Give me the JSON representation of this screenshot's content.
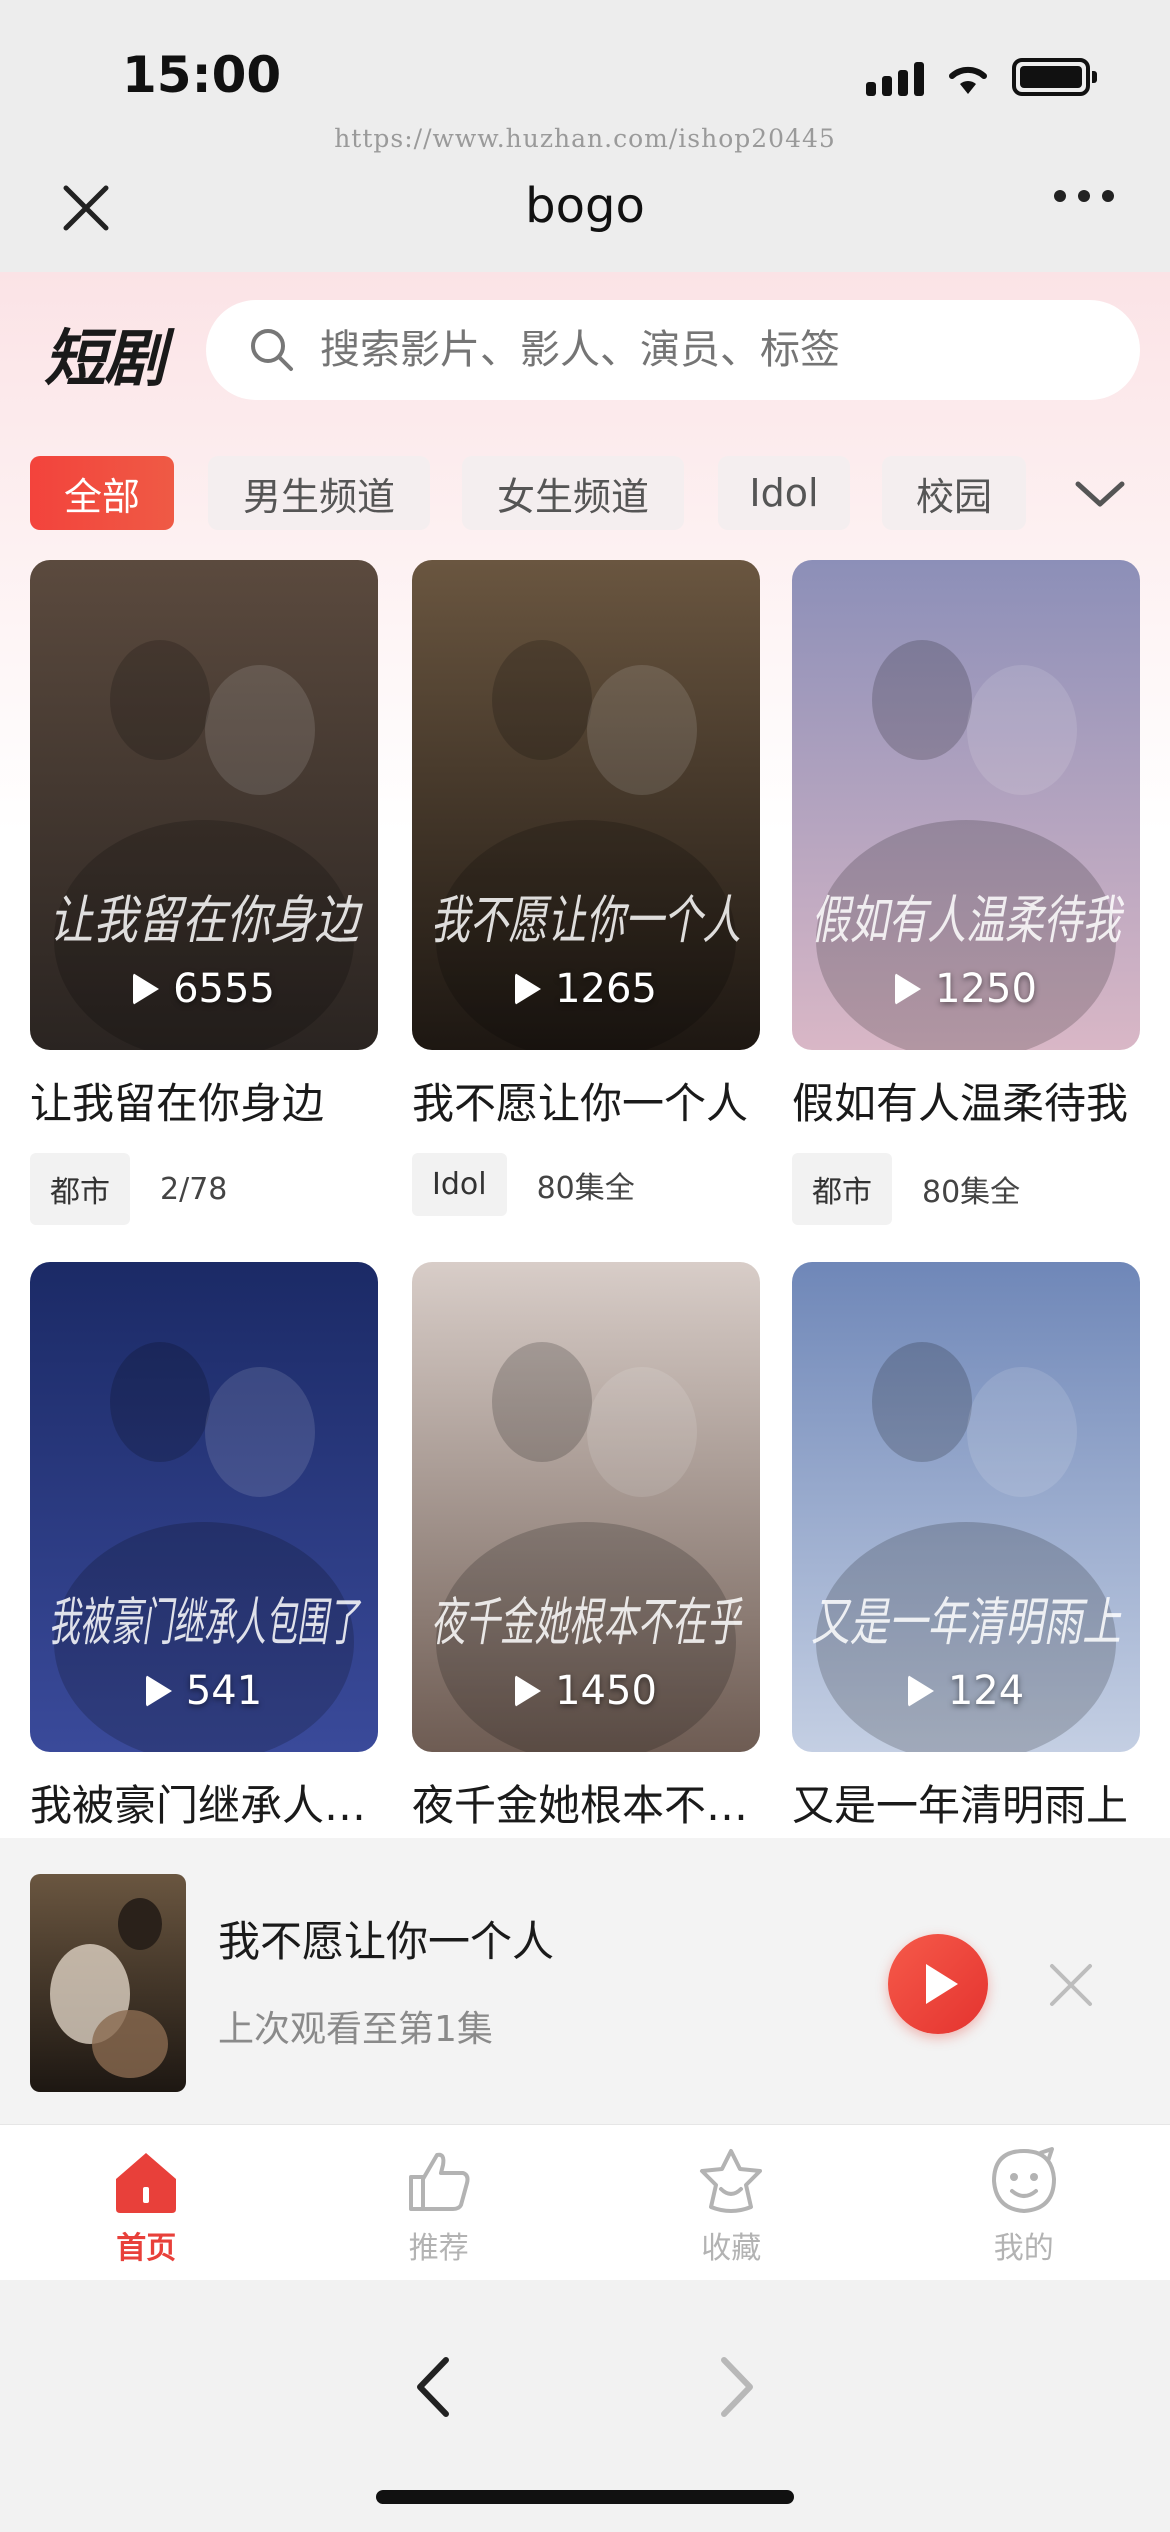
{
  "status": {
    "time": "15:00"
  },
  "watermark": "https://www.huzhan.com/ishop20445",
  "nav": {
    "title": "bogo"
  },
  "header": {
    "brand": "短剧",
    "search_placeholder": "搜索影片、影人、演员、标签"
  },
  "chips": [
    {
      "label": "全部",
      "active": true
    },
    {
      "label": "男生频道",
      "active": false
    },
    {
      "label": "女生频道",
      "active": false
    },
    {
      "label": "Idol",
      "active": false
    },
    {
      "label": "校园",
      "active": false
    }
  ],
  "dramas": [
    {
      "title": "让我留在你身边",
      "plays": "6555",
      "tag": "都市",
      "episodes": "2/78",
      "poster_text": "让我留在你身边",
      "colors": [
        "#5b4a3e",
        "#2a2421"
      ]
    },
    {
      "title": "我不愿让你一个人",
      "plays": "1265",
      "tag": "Idol",
      "episodes": "80集全",
      "poster_text": "我不愿让你一个人",
      "colors": [
        "#6a5640",
        "#1d1712"
      ]
    },
    {
      "title": "假如有人温柔待我",
      "plays": "1250",
      "tag": "都市",
      "episodes": "80集全",
      "poster_text": "假如有人温柔待我",
      "colors": [
        "#8c8fb8",
        "#d9b7c6"
      ]
    },
    {
      "title": "我被豪门继承人包围了",
      "plays": "541",
      "tag": "",
      "episodes": "",
      "poster_text": "我被豪门继承人包围了",
      "colors": [
        "#1b2a66",
        "#3a4a9a"
      ]
    },
    {
      "title": "夜千金她根本不在乎",
      "plays": "1450",
      "tag": "",
      "episodes": "",
      "poster_text": "夜千金她根本不在乎",
      "colors": [
        "#d8cdc8",
        "#6e5c53"
      ]
    },
    {
      "title": "又是一年清明雨上",
      "plays": "124",
      "tag": "",
      "episodes": "",
      "poster_text": "又是一年清明雨上",
      "colors": [
        "#6f87b8",
        "#c4cfe3"
      ]
    }
  ],
  "continue_watching": {
    "title": "我不愿让你一个人",
    "subtitle": "上次观看至第1集"
  },
  "tabs": [
    {
      "label": "首页",
      "icon": "home-icon",
      "active": true
    },
    {
      "label": "推荐",
      "icon": "thumbs-up-icon",
      "active": false
    },
    {
      "label": "收藏",
      "icon": "star-face-icon",
      "active": false
    },
    {
      "label": "我的",
      "icon": "smile-face-icon",
      "active": false
    }
  ],
  "colors": {
    "accent": "#e8403a",
    "inactive": "#b3b3b3"
  }
}
